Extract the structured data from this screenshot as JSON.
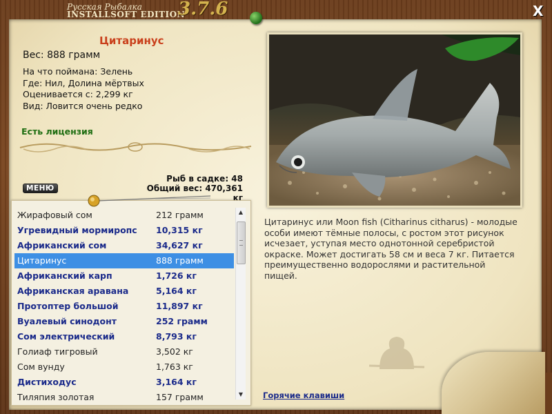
{
  "window": {
    "title_line1": "Русская Рыбалка",
    "title_line2": "INSTALLSOFT EDITION",
    "version": "3.7.6",
    "close_label": "X"
  },
  "fish": {
    "name": "Цитаринус",
    "weight": "Вес: 888 грамм",
    "bait": "На что поймана: Зелень",
    "location": "Где: Нил, Долина мёртвых",
    "valued_from": "Оценивается с: 2,299 кг",
    "rarity": "Вид: Ловится очень редко",
    "license": "Есть лицензия",
    "description": "Цитаринус или Moon fish (Citharinus citharus) - молодые особи имеют тёмные полосы, с ростом этот рисунок исчезает, уступая место однотонной серебристой окраске. Может достигать 58 см и веса 7 кг. Питается преимущественно водорослями и растительной пищей."
  },
  "keepnet": {
    "count": "Рыб в садке: 48",
    "total": "Общий вес: 470,361 кг"
  },
  "menu_label": "МЕНЮ",
  "catch_list": [
    {
      "name": "Жирафовый сом",
      "weight": "212 грамм",
      "style": "plain"
    },
    {
      "name": "Угревидный мормиропс",
      "weight": "10,315 кг",
      "style": "bold"
    },
    {
      "name": "Африканский сом",
      "weight": "34,627 кг",
      "style": "bold"
    },
    {
      "name": "Цитаринус",
      "weight": "888 грамм",
      "style": "selected"
    },
    {
      "name": "Африканский карп",
      "weight": "1,726 кг",
      "style": "bold"
    },
    {
      "name": "Африканская аравана",
      "weight": "5,164 кг",
      "style": "bold"
    },
    {
      "name": "Протоптер большой",
      "weight": "11,897 кг",
      "style": "bold"
    },
    {
      "name": "Вуалевый синодонт",
      "weight": "252 грамм",
      "style": "bold"
    },
    {
      "name": "Сом электрический",
      "weight": "8,793 кг",
      "style": "bold"
    },
    {
      "name": "Голиаф тигровый",
      "weight": "3,502 кг",
      "style": "plain"
    },
    {
      "name": "Сом вунду",
      "weight": "1,763 кг",
      "style": "plain"
    },
    {
      "name": "Дистиходус",
      "weight": "3,164 кг",
      "style": "bold"
    },
    {
      "name": "Тиляпия золотая",
      "weight": "157 грамм",
      "style": "plain"
    }
  ],
  "hotkeys_label": "Горячие клавиши",
  "colors": {
    "fish_name": "#c9401c",
    "license": "#1f6e12",
    "bold_item": "#1a2a8a",
    "selection": "#3d8fe4"
  }
}
